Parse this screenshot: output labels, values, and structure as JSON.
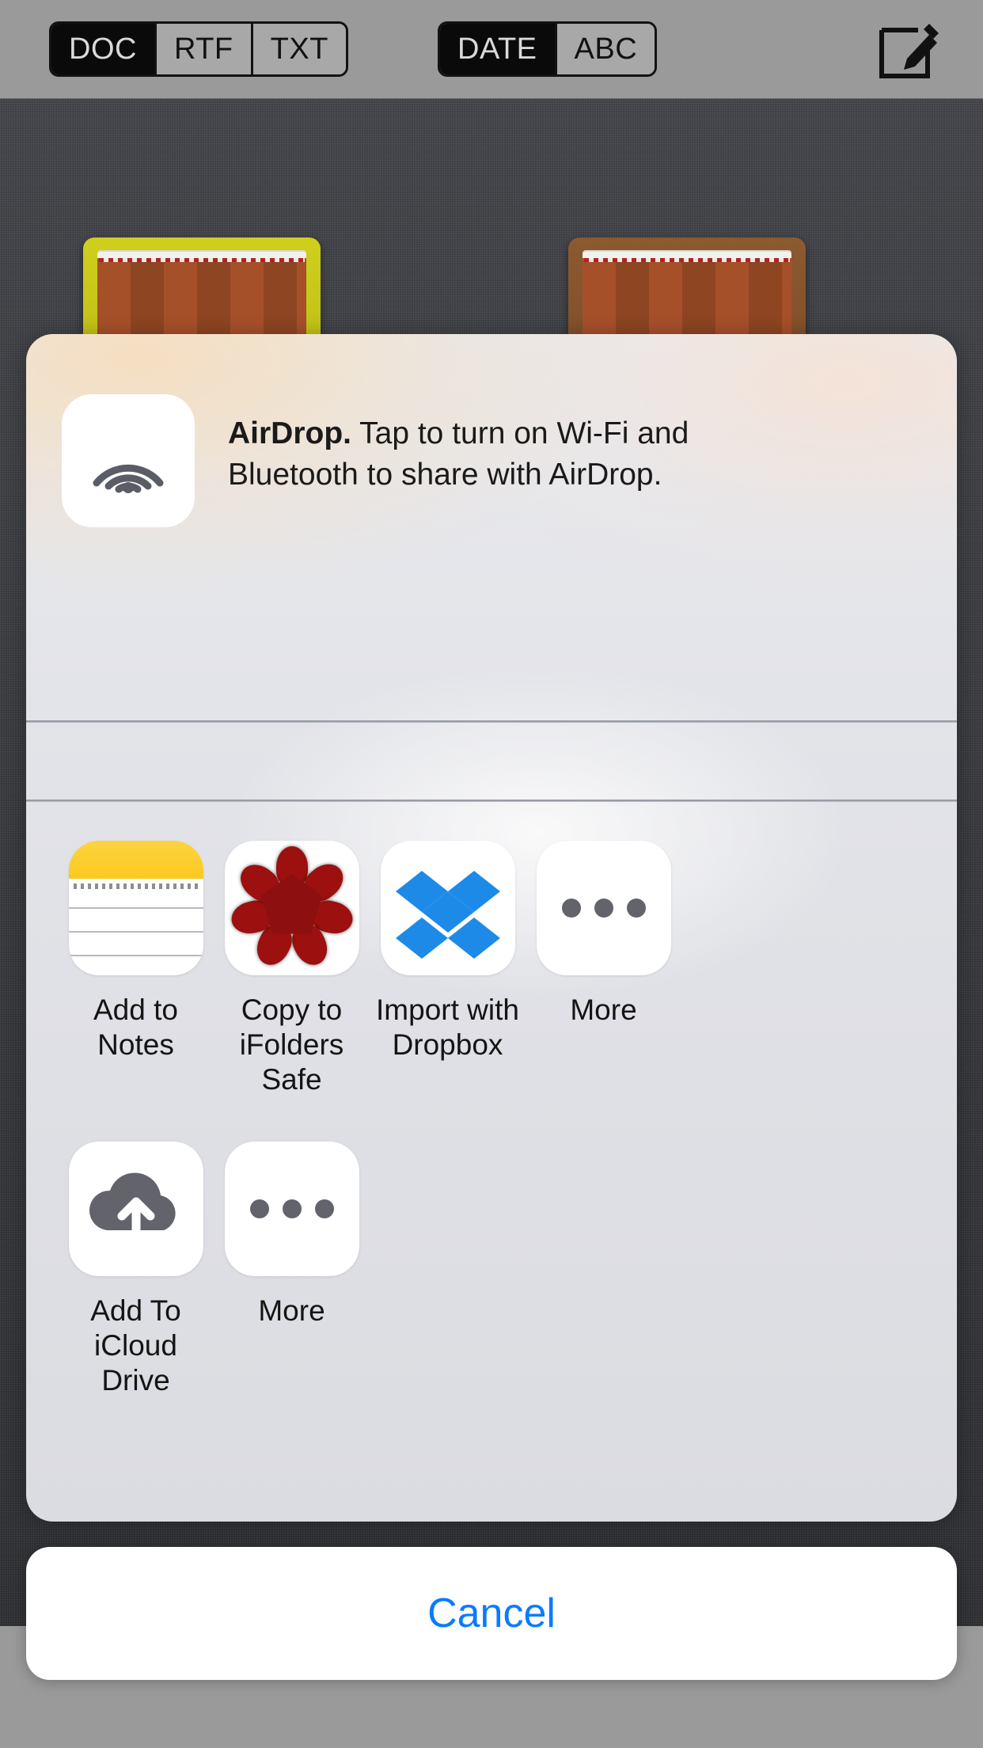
{
  "toolbar": {
    "format_segments": [
      {
        "label": "DOC",
        "selected": true
      },
      {
        "label": "RTF",
        "selected": false
      },
      {
        "label": "TXT",
        "selected": false
      }
    ],
    "sort_segments": [
      {
        "label": "DATE",
        "selected": true
      },
      {
        "label": "ABC",
        "selected": false
      }
    ],
    "compose_icon": "compose-icon"
  },
  "share_sheet": {
    "airdrop": {
      "icon": "airdrop-icon",
      "title": "AirDrop.",
      "message": " Tap to turn on Wi-Fi and Bluetooth to share with AirDrop."
    },
    "apps": [
      {
        "label": "Add to Notes",
        "icon": "notes-icon"
      },
      {
        "label": "Copy to\niFolders Safe",
        "icon": "ifolders-safe-icon"
      },
      {
        "label": "Import with\nDropbox",
        "icon": "dropbox-icon"
      },
      {
        "label": "More",
        "icon": "ellipsis-icon"
      }
    ],
    "actions": [
      {
        "label": "Add To\niCloud Drive",
        "icon": "icloud-upload-icon"
      },
      {
        "label": "More",
        "icon": "ellipsis-icon"
      }
    ],
    "cancel_label": "Cancel"
  },
  "colors": {
    "accent_blue": "#0a7bff",
    "sheet_bg": "#e3e4e9",
    "toolbar_bg": "#9a9a9a",
    "segment_selected_bg": "#0a0a0a",
    "notes_yellow": "#fbc91f",
    "dropbox_blue": "#1e8ae8",
    "safe_red": "#9c1010",
    "icon_gray": "#62636b"
  }
}
